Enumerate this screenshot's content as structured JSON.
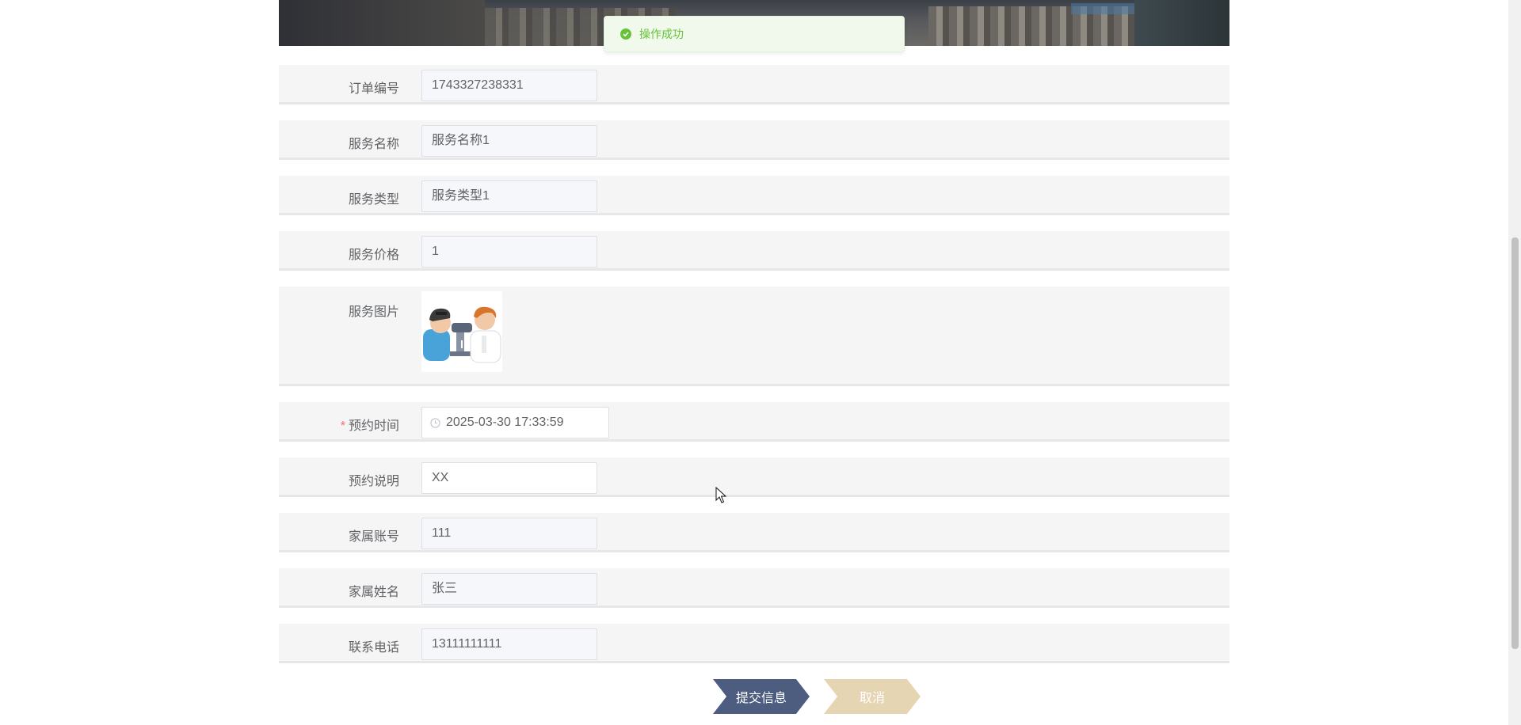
{
  "toast": {
    "message": "操作成功",
    "icon": "check-circle-icon",
    "color": "#67c23a"
  },
  "form": {
    "order_no": {
      "label": "订单编号",
      "value": "1743327238331"
    },
    "service_name": {
      "label": "服务名称",
      "value": "服务名称1"
    },
    "service_type": {
      "label": "服务类型",
      "value": "服务类型1"
    },
    "service_price": {
      "label": "服务价格",
      "value": "1"
    },
    "service_image": {
      "label": "服务图片",
      "image": "eye-exam-illustration"
    },
    "booking_time": {
      "label": "预约时间",
      "required_mark": "*",
      "value": "2025-03-30 17:33:59",
      "icon": "clock-icon"
    },
    "booking_note": {
      "label": "预约说明",
      "value": "XX"
    },
    "family_account": {
      "label": "家属账号",
      "value": "111"
    },
    "family_name": {
      "label": "家属姓名",
      "value": "张三"
    },
    "contact_phone": {
      "label": "联系电话",
      "value": "13111111111"
    }
  },
  "actions": {
    "submit_label": "提交信息",
    "cancel_label": "取消",
    "submit_color": "#4d5d80",
    "cancel_color": "#e6d5b3"
  }
}
